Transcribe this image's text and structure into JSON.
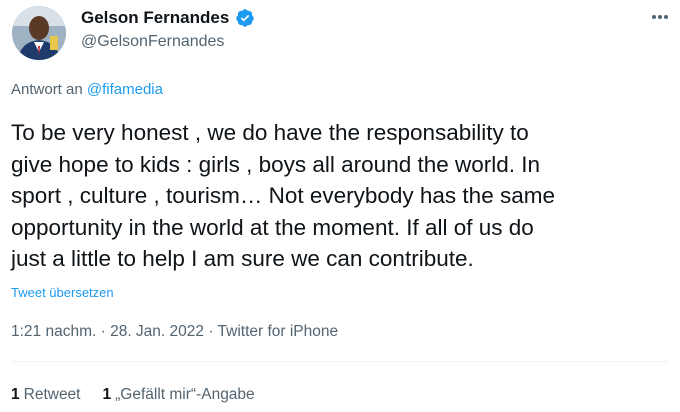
{
  "author": {
    "display_name": "Gelson Fernandes",
    "handle": "@GelsonFernandes",
    "verified_color": "#1d9bf0"
  },
  "reply": {
    "prefix": "Antwort an",
    "mention": "@fifamedia"
  },
  "tweet": {
    "lines": [
      "To be very honest , we do have the responsability to",
      "give hope to kids : girls , boys all around the world. In",
      "sport , culture , tourism… Not everybody has the same",
      "opportunity in the world at the moment. If all of us do",
      "just a little to help I am sure we can contribute."
    ],
    "translate_label": "Tweet übersetzen"
  },
  "meta": {
    "text": "1:21 nachm. · 28. Jan. 2022 · Twitter for iPhone"
  },
  "stats": {
    "retweets_count": "1",
    "retweets_label": "Retweet",
    "likes_count": "1",
    "likes_label": "„Gefällt mir“-Angabe"
  },
  "icons": {
    "verified": "verified-badge-icon",
    "more": "more-options-icon"
  }
}
